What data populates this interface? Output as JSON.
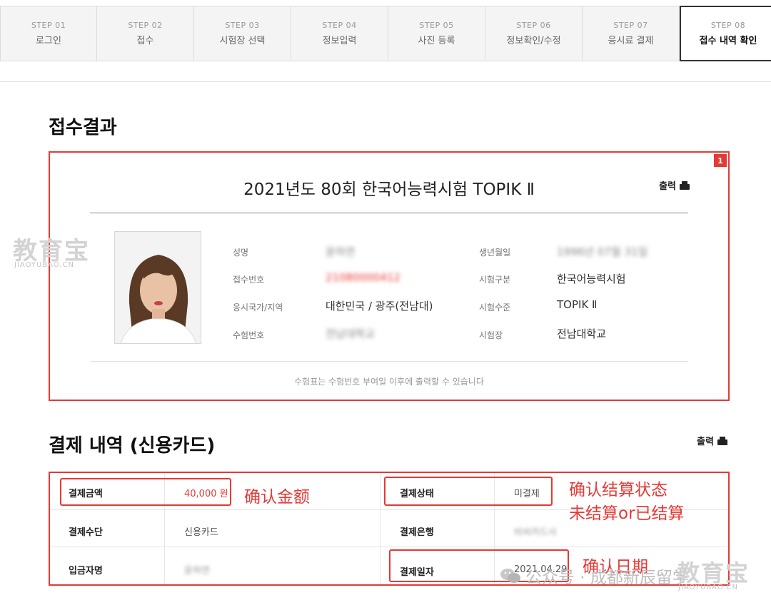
{
  "steps": [
    {
      "num": "STEP 01",
      "label": "로그인"
    },
    {
      "num": "STEP 02",
      "label": "접수"
    },
    {
      "num": "STEP 03",
      "label": "시험장 선택"
    },
    {
      "num": "STEP 04",
      "label": "정보입력"
    },
    {
      "num": "STEP 05",
      "label": "사진 등록"
    },
    {
      "num": "STEP 06",
      "label": "정보확인/수정"
    },
    {
      "num": "STEP 07",
      "label": "응시료 결제"
    },
    {
      "num": "STEP 08",
      "label": "접수 내역 확인"
    }
  ],
  "result": {
    "section_title": "접수결과",
    "box_number": "1",
    "exam_title": "2021년도 80회 한국어능력시험 TOPIK Ⅱ",
    "print_label": "출력",
    "fields": {
      "name_label": "성명",
      "name_value": "윤하연",
      "birth_label": "생년월일",
      "birth_value": "1996년 07월 31일",
      "receipt_label": "접수번호",
      "receipt_value": "21080000412",
      "exam_type_label": "시험구분",
      "exam_type_value": "한국어능력시험",
      "country_label": "응시국가/지역",
      "country_value": "대한민국 / 광주(전남대)",
      "level_label": "시험수준",
      "level_value": "TOPIK Ⅱ",
      "ticket_label": "수험번호",
      "ticket_value": "전남대학교",
      "venue_label": "시험장",
      "venue_value": "전남대학교"
    },
    "notice": "수험표는 수험번호 부여일 이후에 출력할 수 있습니다"
  },
  "payment": {
    "section_title": "결제 내역 (신용카드)",
    "print_label": "출력",
    "amount_label": "결제금액",
    "amount_value": "40,000 원",
    "status_label": "결제상태",
    "status_value": "미결제",
    "method_label": "결제수단",
    "method_value": "신용카드",
    "bank_label": "결제은행",
    "bank_value": "비씨카드사",
    "depositor_label": "입금자명",
    "depositor_value": "윤하연",
    "date_label": "결제일자",
    "date_value": "2021.04.29"
  },
  "annotations": {
    "amount_note": "确认金额",
    "status_note_line1": "确认结算状态",
    "status_note_line2": "未结算or已结算",
    "date_note": "确认日期"
  },
  "watermark": {
    "logo": "教育宝",
    "logo_sub": "JIAOYUBAO.CN",
    "account": "公众号 · 成都新辰留学"
  },
  "colors": {
    "accent_red": "#e53935",
    "highlight_blue": "#bfe0f5",
    "active_step_border": "#333333"
  }
}
